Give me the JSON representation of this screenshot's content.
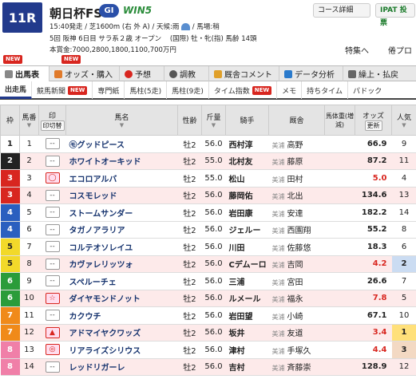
{
  "race": {
    "number": "11R",
    "name": "朝日杯FS",
    "grade": "GI",
    "win5": "WIN5",
    "start_time": "15:40発走",
    "course": "芝1600m (右 外 A)",
    "weather_label": "天候:雨",
    "track_label": "馬場:稍",
    "meeting": "5回 阪神 6日目 サラ系２歳 オープン",
    "conditions": "(国際) 牡・牝(指) 馬齢 14頭",
    "prize": "本賞金:7000,2800,1800,1100,700万円"
  },
  "header_buttons": {
    "course_detail": "コース詳細",
    "ipat": "IPAT 投票",
    "special": "特集へ",
    "other": "倦プロ"
  },
  "badges": {
    "new": "NEW"
  },
  "tabs_main": [
    {
      "label": "出馬表"
    },
    {
      "label": "オッズ・購入"
    },
    {
      "label": "予想"
    },
    {
      "label": "調教"
    },
    {
      "label": "厩舎コメント"
    },
    {
      "label": "データ分析"
    },
    {
      "label": "繰上・払戻"
    }
  ],
  "tabs_sub": [
    {
      "label": "出走馬"
    },
    {
      "label": "競馬新聞"
    },
    {
      "label": "専門紙"
    },
    {
      "label": "馬柱(5走)"
    },
    {
      "label": "馬柱(9走)"
    },
    {
      "label": "タイム指数"
    },
    {
      "label": "メモ"
    },
    {
      "label": "持ちタイム"
    },
    {
      "label": "パドック"
    }
  ],
  "columns": {
    "waku": "枠",
    "umaban": "馬番",
    "mark": "印",
    "mark_sub": "印切替",
    "name": "馬名",
    "sex_age": "性齢",
    "weight": "斤量",
    "jockey": "騎手",
    "trainer": "厩舎",
    "body_weight": "馬体重(増減)",
    "odds": "オッズ",
    "odds_refresh": "更新",
    "popularity": "人気"
  },
  "horses": [
    {
      "waku": "1",
      "num": "1",
      "mark": "--",
      "name": "㋲グッドピース",
      "sexage": "牡2",
      "kin": "56.0",
      "jockey": "西村淳",
      "area": "美浦",
      "trainer": "高野",
      "odds": "66.9",
      "pop": "9"
    },
    {
      "waku": "2",
      "num": "2",
      "mark": "--",
      "name": "ホワイトオーキッド",
      "sexage": "牡2",
      "kin": "55.0",
      "jockey": "北村友",
      "area": "美浦",
      "trainer": "藤原",
      "odds": "87.2",
      "pop": "11"
    },
    {
      "waku": "3",
      "num": "3",
      "mark": "◯",
      "name": "エコロアルバ",
      "sexage": "牡2",
      "kin": "55.0",
      "jockey": "松山",
      "area": "美浦",
      "trainer": "田村",
      "odds": "5.0",
      "pop": "4"
    },
    {
      "waku": "3",
      "num": "4",
      "mark": "--",
      "name": "コスモレッド",
      "sexage": "牡2",
      "kin": "56.0",
      "jockey": "藤岡佑",
      "area": "美浦",
      "trainer": "北出",
      "odds": "134.6",
      "pop": "13"
    },
    {
      "waku": "4",
      "num": "5",
      "mark": "--",
      "name": "ストームサンダー",
      "sexage": "牡2",
      "kin": "56.0",
      "jockey": "岩田康",
      "area": "美浦",
      "trainer": "安達",
      "odds": "182.2",
      "pop": "14"
    },
    {
      "waku": "4",
      "num": "6",
      "mark": "--",
      "name": "タガノアラリア",
      "sexage": "牡2",
      "kin": "56.0",
      "jockey": "ジェルー",
      "area": "美浦",
      "trainer": "西園翔",
      "odds": "55.2",
      "pop": "8"
    },
    {
      "waku": "5",
      "num": "7",
      "mark": "--",
      "name": "コルテオソレイユ",
      "sexage": "牡2",
      "kin": "56.0",
      "jockey": "川田",
      "area": "美浦",
      "trainer": "佐藤悠",
      "odds": "18.3",
      "pop": "6"
    },
    {
      "waku": "5",
      "num": "8",
      "mark": "--",
      "name": "カヴァレリッツォ",
      "sexage": "牡2",
      "kin": "56.0",
      "jockey": "Cデムーロ",
      "area": "美浦",
      "trainer": "吉岡",
      "odds": "4.2",
      "pop": "2"
    },
    {
      "waku": "6",
      "num": "9",
      "mark": "--",
      "name": "スペルーチェ",
      "sexage": "牡2",
      "kin": "56.0",
      "jockey": "三浦",
      "area": "美浦",
      "trainer": "宮田",
      "odds": "26.6",
      "pop": "7"
    },
    {
      "waku": "6",
      "num": "10",
      "mark": "☆",
      "name": "ダイヤモンドノット",
      "sexage": "牡2",
      "kin": "56.0",
      "jockey": "ルメール",
      "area": "美浦",
      "trainer": "福永",
      "odds": "7.8",
      "pop": "5"
    },
    {
      "waku": "7",
      "num": "11",
      "mark": "--",
      "name": "カクウチ",
      "sexage": "牡2",
      "kin": "56.0",
      "jockey": "岩田望",
      "area": "美浦",
      "trainer": "小崎",
      "odds": "67.1",
      "pop": "10"
    },
    {
      "waku": "7",
      "num": "12",
      "mark": "▲",
      "name": "アドマイヤクワッズ",
      "sexage": "牡2",
      "kin": "56.0",
      "jockey": "坂井",
      "area": "美浦",
      "trainer": "友道",
      "odds": "3.4",
      "pop": "1"
    },
    {
      "waku": "8",
      "num": "13",
      "mark": "◎",
      "name": "リアライズシリウス",
      "sexage": "牡2",
      "kin": "56.0",
      "jockey": "津村",
      "area": "美浦",
      "trainer": "手塚久",
      "odds": "4.4",
      "pop": "3"
    },
    {
      "waku": "8",
      "num": "14",
      "mark": "--",
      "name": "レッドリガーレ",
      "sexage": "牡2",
      "kin": "56.0",
      "jockey": "吉村",
      "area": "美浦",
      "trainer": "斉藤崇",
      "odds": "128.9",
      "pop": "12"
    }
  ],
  "colors": {
    "waku1": "#ffffff",
    "waku2": "#222222",
    "waku3": "#d8261f",
    "waku4": "#2a5fbf",
    "waku5": "#f2d92a",
    "waku6": "#2a9c3a",
    "waku7": "#f08a1a",
    "waku8": "#f07fa8",
    "accent": "#223a8c"
  }
}
